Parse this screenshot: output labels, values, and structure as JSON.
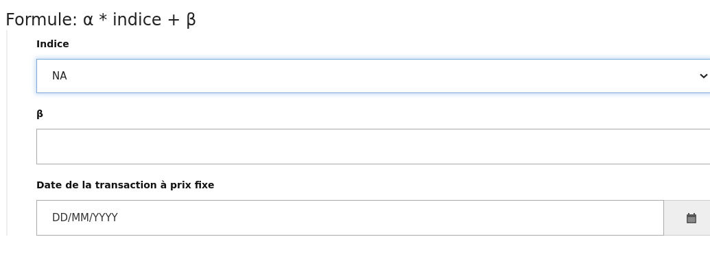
{
  "title": "Formule: α * indice + β",
  "fields": [
    {
      "kind": "select",
      "label": "Indice",
      "value": "NA"
    },
    {
      "kind": "text",
      "label": "β"
    },
    {
      "kind": "date",
      "label": "Date de la transaction à prix fixe",
      "placeholder": "DD/MM/YYYY"
    }
  ]
}
